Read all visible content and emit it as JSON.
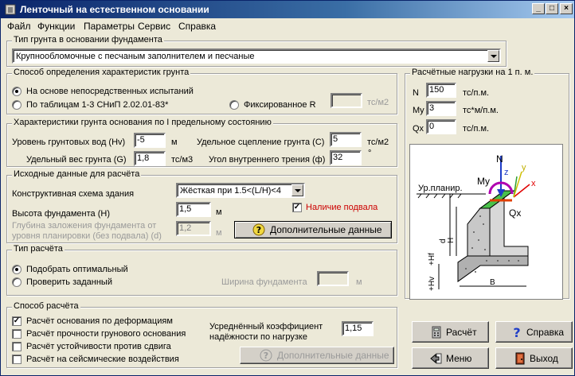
{
  "window": {
    "title": "Ленточный на естественном основании",
    "minimize": "_",
    "maximize": "□",
    "close": "×"
  },
  "menu": [
    "Файл",
    "Функции",
    "Параметры",
    "Сервис",
    "Справка"
  ],
  "soil_type": {
    "title": "Тип грунта в основании фундамента",
    "value": "Крупнообломочные с песчаным заполнителем и песчаные"
  },
  "method": {
    "title": "Способ определения характеристик грунта",
    "options": [
      "На основе непосредственных испытаний",
      "По таблицам 1-3 СНиП 2.02.01-83*",
      "Фиксированное R"
    ],
    "fixed_unit": "тс/м2",
    "fixed_value": ""
  },
  "soil_props": {
    "title": "Характеристики грунта основания по I предельному состоянию",
    "ground_water_label": "Уровень грунтовых вод (Hv)",
    "ground_water_value": "-5",
    "ground_water_unit": "м",
    "cohesion_label": "Удельное сцепление грунта (С)",
    "cohesion_value": "5",
    "cohesion_unit": "тс/м2",
    "weight_label": "Удельный вес грунта (G)",
    "weight_value": "1,8",
    "weight_unit": "тс/м3",
    "friction_label": "Угол внутреннего трения (ф)",
    "friction_value": "32",
    "friction_unit": "°"
  },
  "source": {
    "title": "Исходные данные для расчёта",
    "scheme_label": "Конструктивная схема здания",
    "scheme_value": "Жёсткая при 1.5<(L/H)<4",
    "basement_label": "Наличие подвала",
    "height_label": "Высота фундамента (H)",
    "height_value": "1,5",
    "height_unit": "м",
    "depth_label_1": "Глубина заложения фундамента от",
    "depth_label_2": "уровня планировки (без подвала) (d)",
    "depth_value": "1,2",
    "depth_unit": "м",
    "extra_button": "Дополнительные данные"
  },
  "calc_type": {
    "title": "Тип расчёта",
    "options": [
      "Подобрать оптимальный",
      "Проверить заданный"
    ],
    "width_label": "Ширина фундамента",
    "width_value": "",
    "width_unit": "м"
  },
  "calc_method": {
    "title": "Способ расчёта",
    "checks": [
      {
        "label": "Расчёт основания по деформациям",
        "checked": true
      },
      {
        "label": "Расчёт прочности грунового основания",
        "checked": false
      },
      {
        "label": "Расчёт устойчивости против сдвига",
        "checked": false
      },
      {
        "label": "Расчёт на сейсмические воздействия",
        "checked": false
      }
    ],
    "coef_label_1": "Усреднённый коэффициент",
    "coef_label_2": "надёжности по нагрузке",
    "coef_value": "1,15",
    "extra_button": "Дополнительные данные"
  },
  "loads": {
    "title": "Расчётные нагрузки на 1 п. м.",
    "n_label": "N",
    "n_value": "150",
    "n_unit": "тс/п.м.",
    "my_label": "My",
    "my_value": "3",
    "my_unit": "тс*м/п.м.",
    "qx_label": "Qx",
    "qx_value": "0",
    "qx_unit": "тс/п.м."
  },
  "diagram": {
    "level": "Ур.планир.",
    "n": "N",
    "my": "My",
    "qx": "Qx",
    "z": "z",
    "y": "y",
    "x": "x",
    "h": "H",
    "d": "d",
    "hf": "+Hf",
    "hv": "+Hv",
    "b": "B"
  },
  "buttons": {
    "calc": "Расчёт",
    "help": "Справка",
    "menu": "Меню",
    "exit": "Выход"
  },
  "colors": {
    "titlebar": "#0a246a",
    "accent_red": "#cc0000",
    "help_blue": "#1e3cc8"
  }
}
